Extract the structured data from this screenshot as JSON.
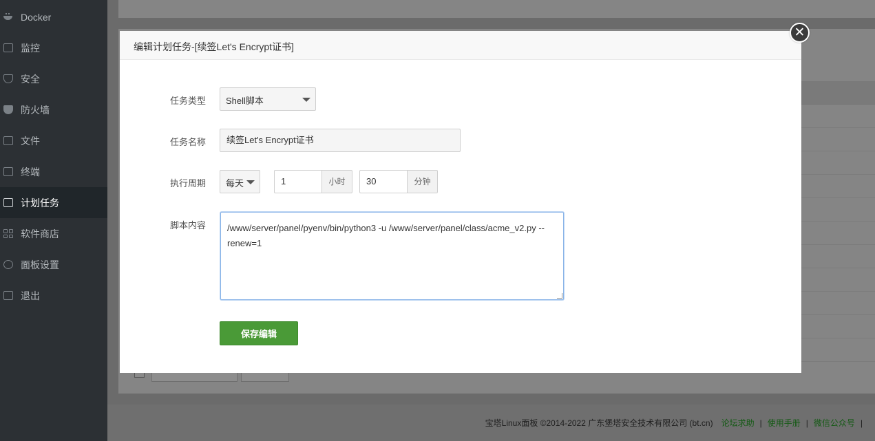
{
  "sidebar": {
    "items": [
      {
        "label": "Docker",
        "icon": "docker-icon"
      },
      {
        "label": "监控",
        "icon": "monitor-icon"
      },
      {
        "label": "安全",
        "icon": "shield-icon"
      },
      {
        "label": "防火墙",
        "icon": "firewall-icon"
      },
      {
        "label": "文件",
        "icon": "folder-icon"
      },
      {
        "label": "终端",
        "icon": "terminal-icon"
      },
      {
        "label": "计划任务",
        "icon": "calendar-icon"
      },
      {
        "label": "软件商店",
        "icon": "grid-icon"
      },
      {
        "label": "面板设置",
        "icon": "gear-icon"
      },
      {
        "label": "退出",
        "icon": "logout-icon"
      }
    ],
    "active_label": "计划任务"
  },
  "modal": {
    "title": "编辑计划任务-[续签Let's Encrypt证书]",
    "close_glyph": "✕",
    "task_type": {
      "label": "任务类型",
      "value": "Shell脚本"
    },
    "task_name": {
      "label": "任务名称",
      "value": "续签Let's Encrypt证书"
    },
    "cycle": {
      "label": "执行周期",
      "period": "每天",
      "hour_value": "1",
      "hour_unit": "小时",
      "minute_value": "30",
      "minute_unit": "分钟"
    },
    "script": {
      "label": "脚本内容",
      "value": "/www/server/panel/pyenv/bin/python3 -u /www/server/panel/class/acme_v2.py --renew=1"
    },
    "save_button": "保存编辑"
  },
  "footer": {
    "copyright": "宝塔Linux面板 ©2014-2022 广东堡塔安全技术有限公司 (bt.cn)",
    "links": [
      "论坛求助",
      "使用手册",
      "微信公众号"
    ],
    "separator": "|"
  },
  "colors": {
    "sidebar_bg": "#2c3034",
    "primary_green": "#4a9a37",
    "link_green": "#20a53a"
  }
}
